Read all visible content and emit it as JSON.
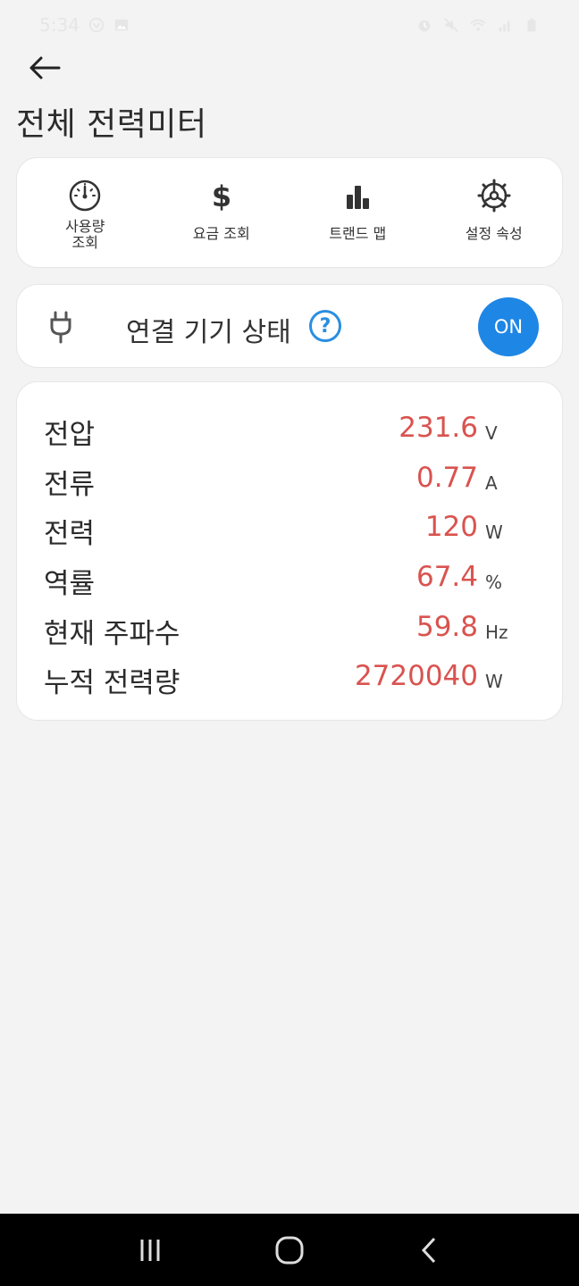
{
  "status_bar": {
    "time": "5:34",
    "left_icons": [
      "app-notification-icon",
      "gallery-icon"
    ],
    "right_icons": [
      "alarm-icon",
      "mute-icon",
      "wifi-icon",
      "signal-icon",
      "battery-icon"
    ]
  },
  "header": {
    "title": "전체 전력미터",
    "back_icon": "back-arrow-icon"
  },
  "menu": {
    "items": [
      {
        "label": "사용량\n조회",
        "icon": "gauge-icon"
      },
      {
        "label": "요금 조회",
        "icon": "dollar-icon"
      },
      {
        "label": "트랜드 맵",
        "icon": "bar-chart-icon"
      },
      {
        "label": "설정 속성",
        "icon": "settings-icon"
      }
    ]
  },
  "device_status": {
    "label": "연결 기기 상태",
    "help_label": "?",
    "toggle_label": "ON",
    "accent_color": "#1e86e5"
  },
  "readings": {
    "value_color": "#d9534f",
    "rows": [
      {
        "label": "전압",
        "value": "231.6",
        "unit": "V"
      },
      {
        "label": "전류",
        "value": "0.77",
        "unit": "A"
      },
      {
        "label": "전력",
        "value": "120",
        "unit": "W"
      },
      {
        "label": "역률",
        "value": "67.4",
        "unit": "%"
      },
      {
        "label": "현재 주파수",
        "value": "59.8",
        "unit": "Hz"
      },
      {
        "label": "누적 전력량",
        "value": "2720040",
        "unit": "W"
      }
    ]
  },
  "nav_bar": {
    "buttons": [
      "recent-apps-icon",
      "home-icon",
      "nav-back-icon"
    ]
  }
}
